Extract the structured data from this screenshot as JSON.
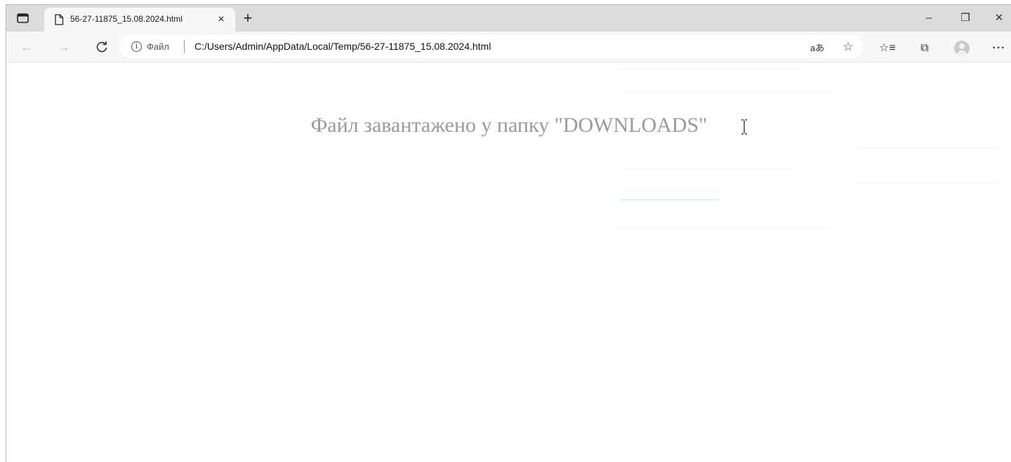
{
  "tab": {
    "title": "56-27-11875_15.08.2024.html",
    "close_glyph": "×"
  },
  "new_tab_glyph": "+",
  "window_controls": {
    "minimize": "–",
    "maximize": "❐",
    "close": "✕"
  },
  "toolbar": {
    "back_glyph": "←",
    "forward_glyph": "→",
    "reload_glyph": "C",
    "info_glyph": "i",
    "scheme_label": "Файл",
    "url": "C:/Users/Admin/AppData/Local/Temp/56-27-11875_15.08.2024.html",
    "read_aloud": "aあ",
    "add_favorite_glyph": "☆",
    "favorites_glyph": "☆≡",
    "collections_glyph": "⧉",
    "more_glyph": "···"
  },
  "page": {
    "message": "Файл завантажено у папку \"DOWNLOADS\""
  },
  "colors": {
    "tabstrip": "#dcdcdc",
    "toolbar": "#f7f7f7",
    "message_text": "#9a9a9a"
  }
}
